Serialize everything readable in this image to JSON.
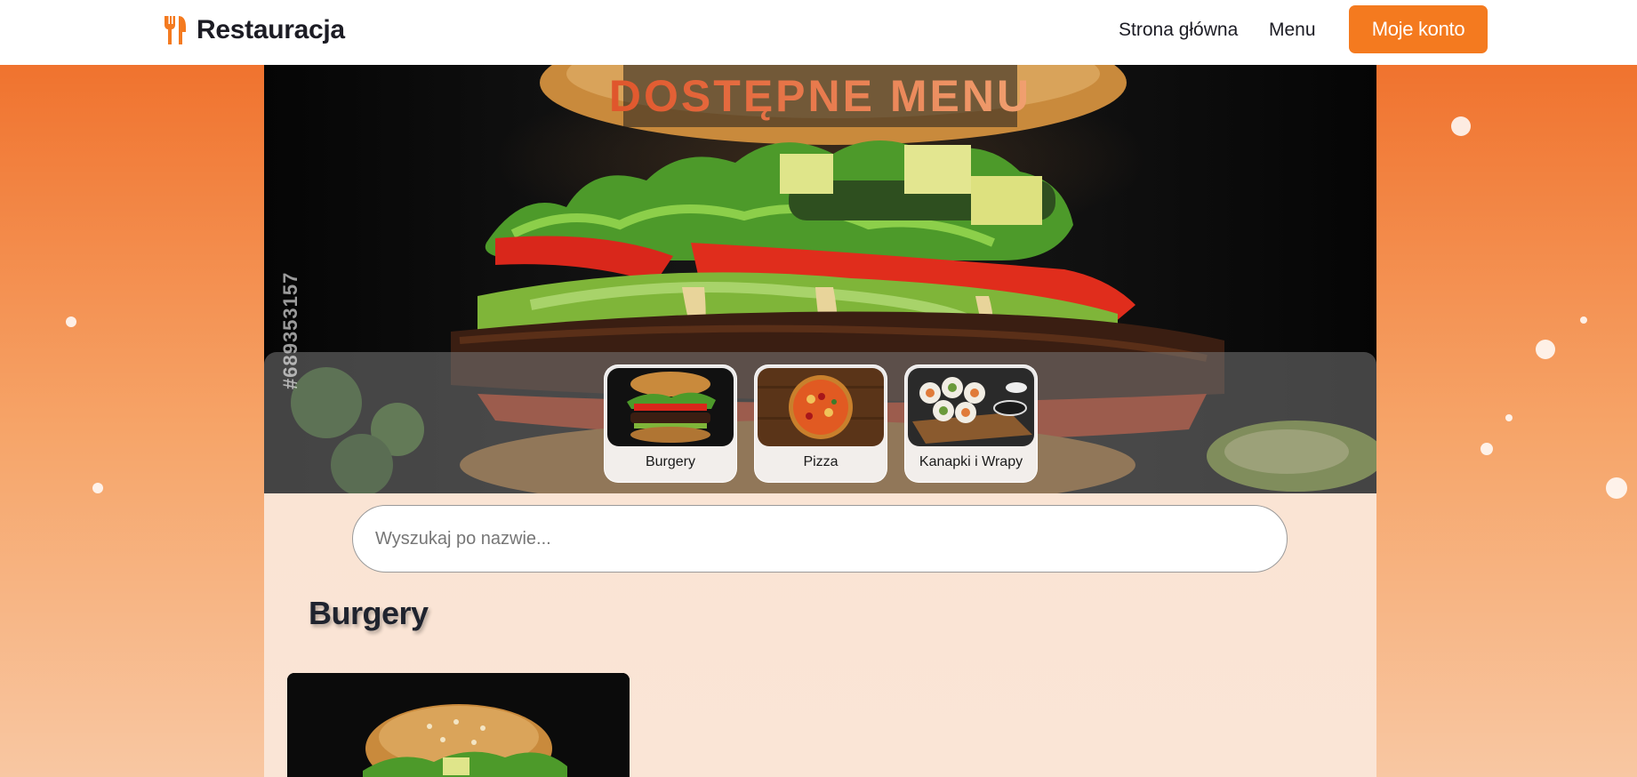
{
  "brand": {
    "name": "Restauracja",
    "icon": "fork-knife-icon"
  },
  "nav": {
    "home_label": "Strona główna",
    "menu_label": "Menu",
    "account_label": "Moje konto"
  },
  "hero": {
    "title": "DOSTĘPNE MENU",
    "stock_id": "#689353157"
  },
  "categories": [
    {
      "label": "Burgery",
      "image": "burger-image"
    },
    {
      "label": "Pizza",
      "image": "pizza-image"
    },
    {
      "label": "Kanapki i Wrapy",
      "image": "sushi-wrap-image"
    }
  ],
  "search": {
    "placeholder": "Wyszukaj po nazwie...",
    "value": ""
  },
  "section": {
    "title": "Burgery"
  },
  "colors": {
    "accent": "#f47a1f",
    "background_top": "#ef6a24",
    "panel": "#fbe2d1",
    "text_dark": "#1c1c24"
  }
}
